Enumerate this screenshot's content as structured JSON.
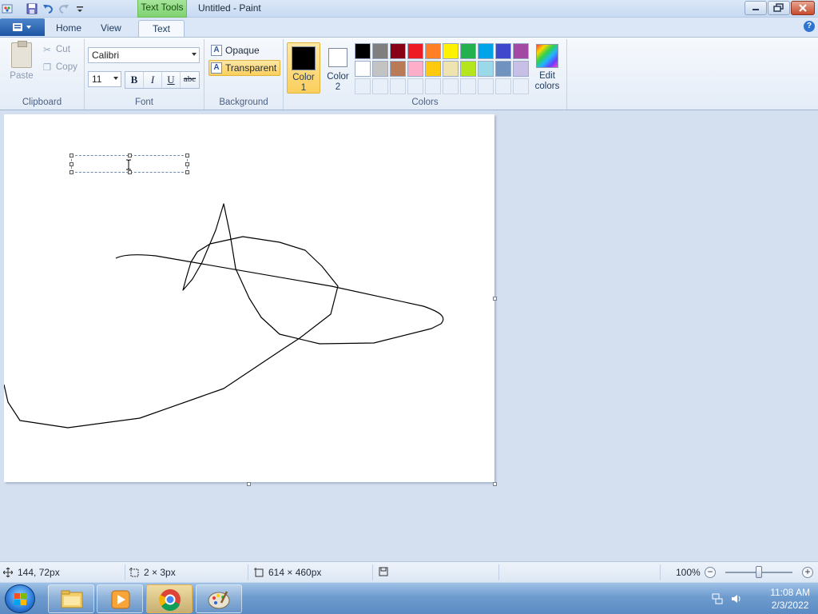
{
  "window": {
    "title": "Untitled - Paint",
    "context_tab": "Text Tools"
  },
  "tabs": [
    {
      "label": "Home",
      "active": false
    },
    {
      "label": "View",
      "active": false
    },
    {
      "label": "Text",
      "active": true
    }
  ],
  "clipboard": {
    "paste_label": "Paste",
    "cut_label": "Cut",
    "copy_label": "Copy",
    "group_label": "Clipboard"
  },
  "font": {
    "family": "Calibri",
    "size": "11",
    "bold": "B",
    "italic": "I",
    "underline": "U",
    "strikethrough": "abc",
    "group_label": "Font"
  },
  "background": {
    "opaque_label": "Opaque",
    "transparent_label": "Transparent",
    "selected": "Transparent",
    "group_label": "Background"
  },
  "colors": {
    "color1_label": "Color 1",
    "color1_value": "#000000",
    "color2_label": "Color 2",
    "color2_value": "#ffffff",
    "edit_label": "Edit colors",
    "group_label": "Colors",
    "palette_row1": [
      "#000000",
      "#7f7f7f",
      "#880015",
      "#ed1c24",
      "#ff7f27",
      "#fff200",
      "#22b14c",
      "#00a2e8",
      "#3f48cc",
      "#a349a4"
    ],
    "palette_row2": [
      "#ffffff",
      "#c3c3c3",
      "#b97a57",
      "#ffaec9",
      "#ffc90e",
      "#efe4b0",
      "#b5e61d",
      "#99d9ea",
      "#7092be",
      "#c8bfe7"
    ],
    "palette_row3_empty": 10
  },
  "status": {
    "cursor_pos": "144, 72px",
    "selection_size": "2 × 3px",
    "canvas_size": "614 × 460px",
    "zoom": "100%"
  },
  "taskbar": {
    "apps": [
      "explorer-app",
      "media-player-app",
      "chrome-app",
      "paint-app"
    ],
    "time": "11:08 AM",
    "date": "2/3/2022"
  }
}
